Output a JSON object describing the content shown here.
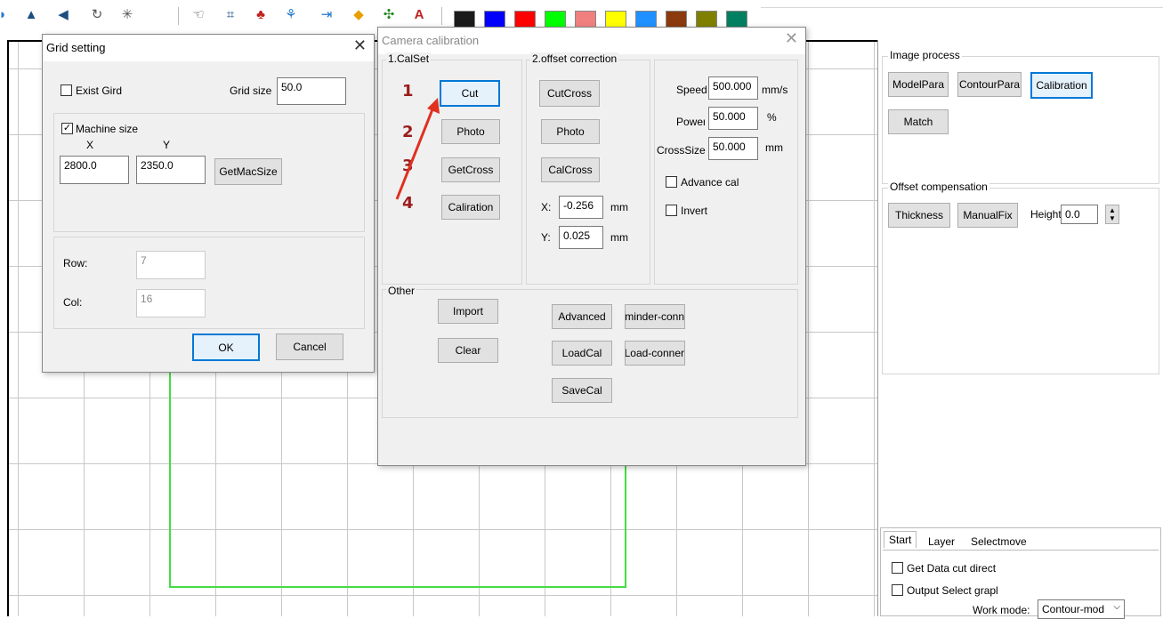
{
  "toolbar": {
    "icons": [
      "circle-half-icon",
      "mirror-icon",
      "arrow-left-icon",
      "rotate-icon",
      "star-icon",
      "hand-icon",
      "crop-icon",
      "stamp-icon",
      "tree-icon",
      "measure-icon",
      "node-icon",
      "select-icon",
      "text-select-icon"
    ],
    "swatches": [
      "#1a1a1a",
      "#0000ff",
      "#ff0000",
      "#00ff00",
      "#f08080",
      "#ffff00",
      "#1e90ff",
      "#8b3a0e",
      "#808000",
      "#008060"
    ]
  },
  "grid_setting": {
    "title": "Grid setting",
    "exist_grid_label": "Exist Gird",
    "exist_grid_checked": false,
    "grid_size_label": "Grid size",
    "grid_size_value": "50.0",
    "machine_size_label": "Machine size",
    "machine_size_checked": true,
    "x_label": "X",
    "y_label": "Y",
    "x_value": "2800.0",
    "y_value": "2350.0",
    "getmacsize_label": "GetMacSize",
    "row_label": "Row:",
    "row_value": "7",
    "col_label": "Col:",
    "col_value": "16",
    "ok_label": "OK",
    "cancel_label": "Cancel"
  },
  "camera_calibration": {
    "title": "Camera calibration",
    "calset_title": "1.CalSet",
    "markers": [
      "1",
      "2",
      "3",
      "4"
    ],
    "cut_label": "Cut",
    "photo_label": "Photo",
    "getcross_label": "GetCross",
    "calibration_label": "Caliration",
    "offset_title": "2.offset correction",
    "cutcross_label": "CutCross",
    "photo2_label": "Photo",
    "calcross_label": "CalCross",
    "x_label": "X:",
    "x_value": "-0.256",
    "y_label": "Y:",
    "y_value": "0.025",
    "mm": "mm",
    "speed_label": "Speed",
    "speed_value": "500.000",
    "speed_unit": "mm/s",
    "power_label": "Power",
    "power_value": "50.000",
    "power_unit": "%",
    "crosssize_label": "CrossSize",
    "crosssize_value": "50.000",
    "advance_cal_label": "Advance cal",
    "invert_label": "Invert",
    "other_title": "Other",
    "import_label": "Import",
    "clear_label": "Clear",
    "advanced_label": "Advanced",
    "reminder_label": "Reminder-conn",
    "loadcal_label": "LoadCal",
    "loadconn_label": "Load-conner",
    "savecal_label": "SaveCal"
  },
  "right_panel": {
    "image_process_title": "Image process",
    "modelpara_label": "ModelPara",
    "contourpara_label": "ContourPara",
    "calibration_label": "Calibration",
    "match_label": "Match",
    "offset_title": "Offset compensation",
    "thickness_label": "Thickness",
    "manualfix_label": "ManualFix",
    "height_label": "Height",
    "height_value": "0.0",
    "tabs": [
      "Start",
      "Layer",
      "Selectmove"
    ],
    "get_data_label": "Get Data cut direct",
    "output_select_label": "Output Select grapl",
    "work_mode_label": "Work mode:",
    "work_mode_value": "Contour-mod"
  }
}
